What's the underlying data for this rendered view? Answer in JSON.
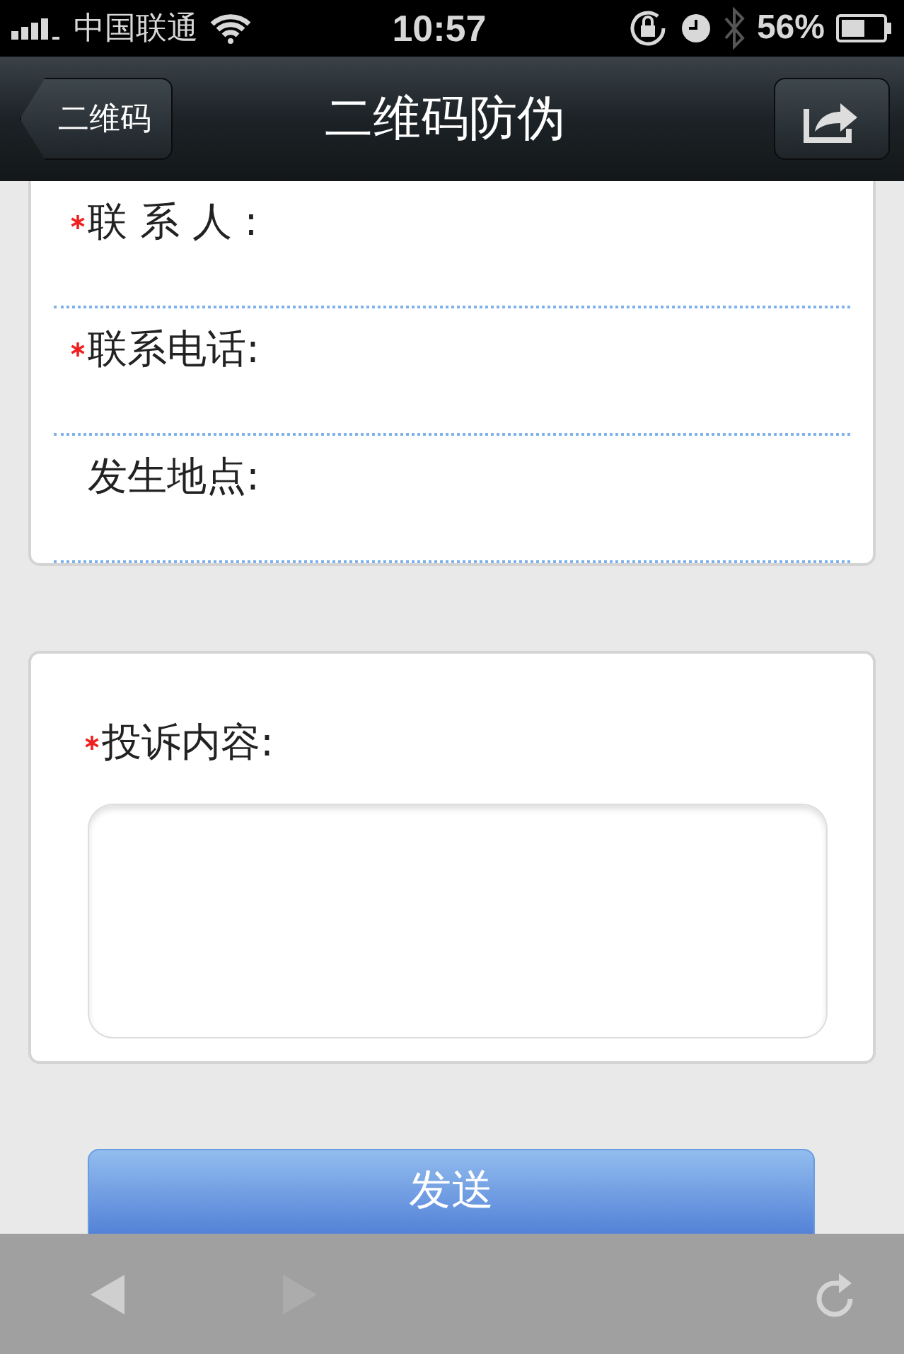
{
  "status_bar": {
    "carrier": "中国联通",
    "time": "10:57",
    "battery": "56%"
  },
  "nav_bar": {
    "back_label": "二维码",
    "title": "二维码防伪"
  },
  "contact_fields": [
    {
      "label": "联 系 人 :",
      "required": true
    },
    {
      "label": "联系电话:",
      "required": true
    },
    {
      "label": "发生地点:",
      "required": false
    }
  ],
  "complaint": {
    "label": "投诉内容:",
    "required": true
  },
  "submit_label": "发送",
  "toolbar": {
    "back_disabled": false,
    "forward_disabled": true
  }
}
